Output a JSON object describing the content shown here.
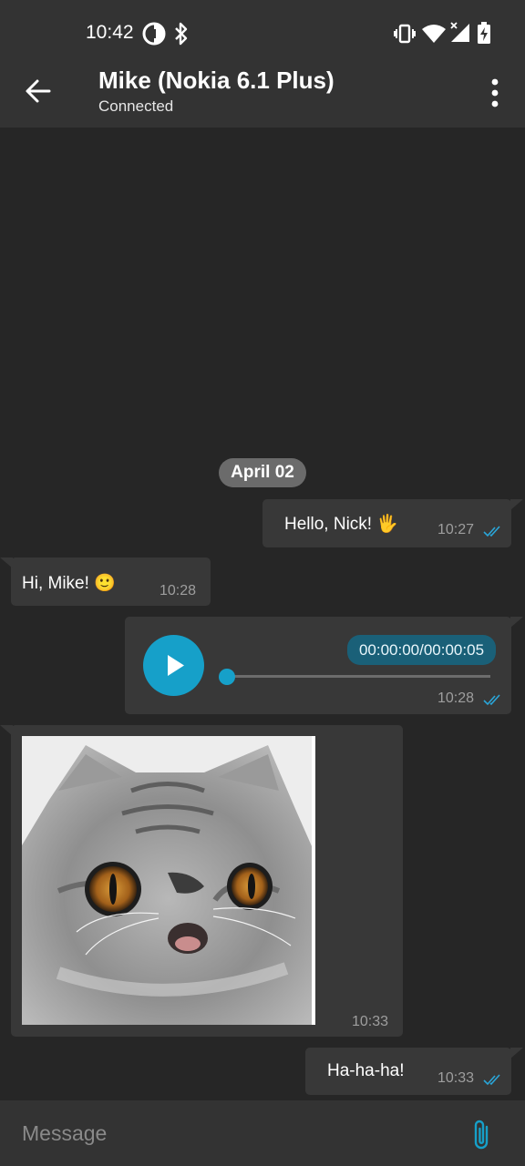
{
  "status_bar": {
    "time": "10:42",
    "icons": [
      "data-saver-icon",
      "bluetooth-icon",
      "vibrate-icon",
      "wifi-icon",
      "signal-no-data-icon",
      "battery-charging-icon"
    ]
  },
  "header": {
    "title": "Mike (Nokia 6.1 Plus)",
    "subtitle": "Connected",
    "back_icon": "arrow-back-icon",
    "menu_icon": "more-vert-icon"
  },
  "conversation": {
    "date_label": "April 02",
    "messages": [
      {
        "direction": "outgoing",
        "type": "text",
        "text": "Hello, Nick! 🖐",
        "time": "10:27",
        "read": true
      },
      {
        "direction": "incoming",
        "type": "text",
        "text": "Hi, Mike! 🙂",
        "time": "10:28"
      },
      {
        "direction": "outgoing",
        "type": "audio",
        "position": "00:00:00/00:00:05",
        "progress": 0,
        "time": "10:28",
        "read": true
      },
      {
        "direction": "incoming",
        "type": "image",
        "image": "grey-tabby-cat-photo",
        "time": "10:33"
      },
      {
        "direction": "outgoing",
        "type": "text",
        "text": "Ha-ha-ha!",
        "time": "10:33",
        "read": true
      }
    ]
  },
  "composer": {
    "placeholder": "Message",
    "attach_icon": "paperclip-icon"
  },
  "colors": {
    "background": "#262626",
    "bars": "#333333",
    "bubble": "#383838",
    "accent": "#16a0c9",
    "read_ticks": "#2aa6d9",
    "date_chip": "#6b6b6b"
  }
}
